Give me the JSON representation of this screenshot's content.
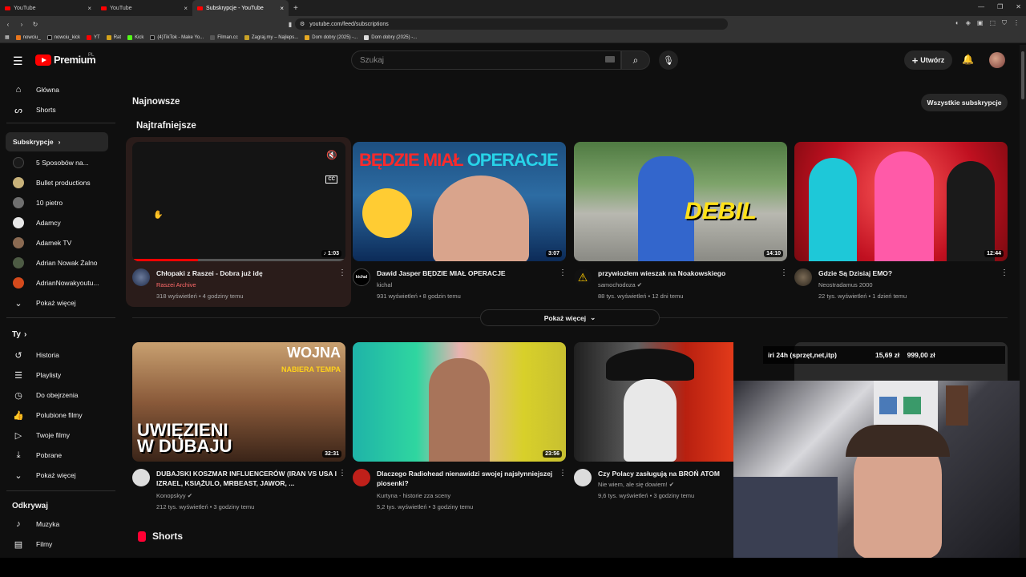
{
  "browser": {
    "tabs": [
      {
        "label": "YouTube",
        "active": false
      },
      {
        "label": "YouTube",
        "active": false
      },
      {
        "label": "Subskrypcje - YouTube",
        "active": true
      }
    ],
    "url": "youtube.com/feed/subscriptions",
    "bookmarks": [
      "nowciu_",
      "nowciu_kick",
      "YT",
      "Rat",
      "Kick",
      "(4)TikTok - Make Yo...",
      "Filman.cc",
      "Zagraj.my – Najleps...",
      "Dom dobry (2025) -...",
      "Dom dobry (2025) -..."
    ]
  },
  "header": {
    "logo_text": "Premium",
    "logo_region": "PL",
    "search_placeholder": "Szukaj",
    "create_label": "Utwórz"
  },
  "sidebar": {
    "main": [
      {
        "label": "Główna",
        "icon": "home-icon"
      },
      {
        "label": "Shorts",
        "icon": "shorts-icon"
      }
    ],
    "subs_header": "Subskrypcje",
    "channels": [
      {
        "label": "5 Sposobów na...",
        "color": "#1a1a1a"
      },
      {
        "label": "Bullet productions",
        "color": "#c8b27a"
      },
      {
        "label": "10 pietro",
        "color": "#6f6f6f"
      },
      {
        "label": "Adamcy",
        "color": "#e8e8e8"
      },
      {
        "label": "Adamek TV",
        "color": "#8a6a52"
      },
      {
        "label": "Adrian Nowak Żalno",
        "color": "#4d5b44"
      },
      {
        "label": "AdrianNowakyoutu...",
        "color": "#d44a1c"
      }
    ],
    "show_more_subs": "Pokaż więcej",
    "you_header": "Ty",
    "you_items": [
      {
        "label": "Historia",
        "icon": "history-icon"
      },
      {
        "label": "Playlisty",
        "icon": "playlist-icon"
      },
      {
        "label": "Do obejrzenia",
        "icon": "watch-later-icon"
      },
      {
        "label": "Polubione filmy",
        "icon": "like-icon"
      },
      {
        "label": "Twoje filmy",
        "icon": "your-videos-icon"
      },
      {
        "label": "Pobrane",
        "icon": "download-icon"
      }
    ],
    "show_more_you": "Pokaż więcej",
    "explore_header": "Odkrywaj",
    "explore_items": [
      {
        "label": "Muzyka",
        "icon": "music-icon"
      },
      {
        "label": "Filmy",
        "icon": "movies-icon"
      }
    ]
  },
  "main": {
    "title": "Najnowsze",
    "all_subs_button": "Wszystkie subskrypcje",
    "section_title": "Najtrafniejsze",
    "show_more": "Pokaż więcej",
    "row1": [
      {
        "title": "Chłopaki z Raszei - Dobra już idę",
        "channel": "Raszei Archive",
        "views": "318 wyświetleń",
        "age": "4 godziny temu",
        "duration": "1:03",
        "verified": false
      },
      {
        "title": "Dawid Jasper BĘDZIE MIAŁ OPERACJE",
        "channel": "kichal",
        "views": "931 wyświetleń",
        "age": "8 godzin temu",
        "duration": "3:07",
        "verified": false
      },
      {
        "title": "przywiozłem wieszak na Noakowskiego",
        "channel": "samochodoza",
        "views": "88 tys. wyświetleń",
        "age": "12 dni temu",
        "duration": "14:10",
        "verified": true
      },
      {
        "title": "Gdzie Są Dzisiaj EMO?",
        "channel": "Neostradamus 2000",
        "views": "22 tys. wyświetleń",
        "age": "1 dzień temu",
        "duration": "12:44",
        "verified": false
      }
    ],
    "row2": [
      {
        "title": "DUBAJSKI KOSZMAR INFLUENCERÓW (IRAN VS USA I IZRAEL, KSIĄŻULO, MRBEAST, JAWOR, ...",
        "channel": "Konopskyy",
        "views": "212 tys. wyświetleń",
        "age": "3 godziny temu",
        "duration": "32:31",
        "verified": true
      },
      {
        "title": "Dlaczego Radiohead nienawidzi swojej najsłynniejszej piosenki?",
        "channel": "Kurtyna - historie zza sceny",
        "views": "5,2 tys. wyświetleń",
        "age": "3 godziny temu",
        "duration": "23:56",
        "verified": false
      },
      {
        "title": "Czy Polacy zasługują na BROŃ ATOM",
        "channel": "Nie wiem, ale się dowiem!",
        "views": "9,6 tys. wyświetleń",
        "age": "3 godziny temu",
        "duration": "",
        "verified": true
      }
    ],
    "thumb_texts": {
      "t2": "BĘDZIE MIAŁ",
      "t2b": "OPERACJE",
      "t3": "DEBIL",
      "r2a": "WOJNA",
      "r2b": "NABIERA TEMPA",
      "r2c": "UWIĘZIENI",
      "r2d": "W DUBAJU"
    },
    "shorts_title": "Shorts",
    "overlay": {
      "text1": "iri 24h (sprzęt,net,itp)",
      "text2": "15,69 zł",
      "text3": "999,00 zł"
    }
  },
  "colors": {
    "brand": "#ff0000",
    "bg": "#0f0f0f"
  }
}
